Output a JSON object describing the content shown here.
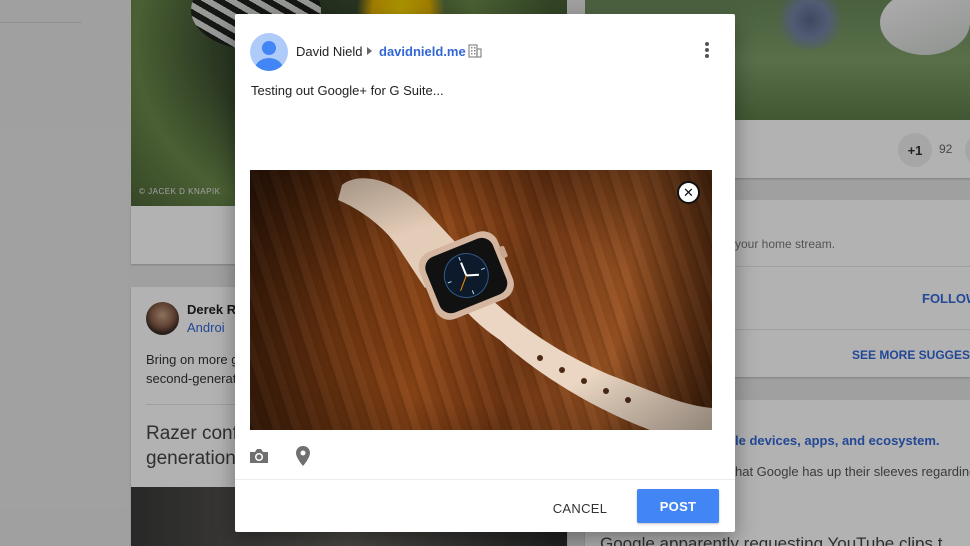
{
  "background": {
    "photo_credit": "© JACEK D KNAPIK",
    "plus_one": {
      "label": "+1",
      "count": "92"
    },
    "suggestions": {
      "text": "your home stream.",
      "follow_label": "FOLLOW",
      "see_more_label": "SEE MORE SUGGEST"
    },
    "article": {
      "link_text": "le devices, apps, and ecosystem.",
      "snippet": "hat Google has up their sleeves regarding",
      "bottom_title": "Google apparently requesting YouTube clips t"
    },
    "post": {
      "author": "Derek Ro",
      "community": "Androi",
      "body_line1": "Bring on more g",
      "body_line2": "second-generat",
      "title_line1": "Razer conf",
      "title_line2": "generation"
    }
  },
  "dialog": {
    "author_name": "David Nield",
    "domain": "davidnield.me",
    "post_text": "Testing out Google+ for G Suite...",
    "remove_image_symbol": "✕",
    "cancel_label": "CANCEL",
    "post_label": "POST"
  },
  "colors": {
    "accent_blue": "#4285f4",
    "link_blue": "#3367d6"
  },
  "icons": [
    "building-icon",
    "more-vert-icon",
    "close-icon",
    "camera-icon",
    "location-pin-icon",
    "avatar-placeholder-icon"
  ]
}
